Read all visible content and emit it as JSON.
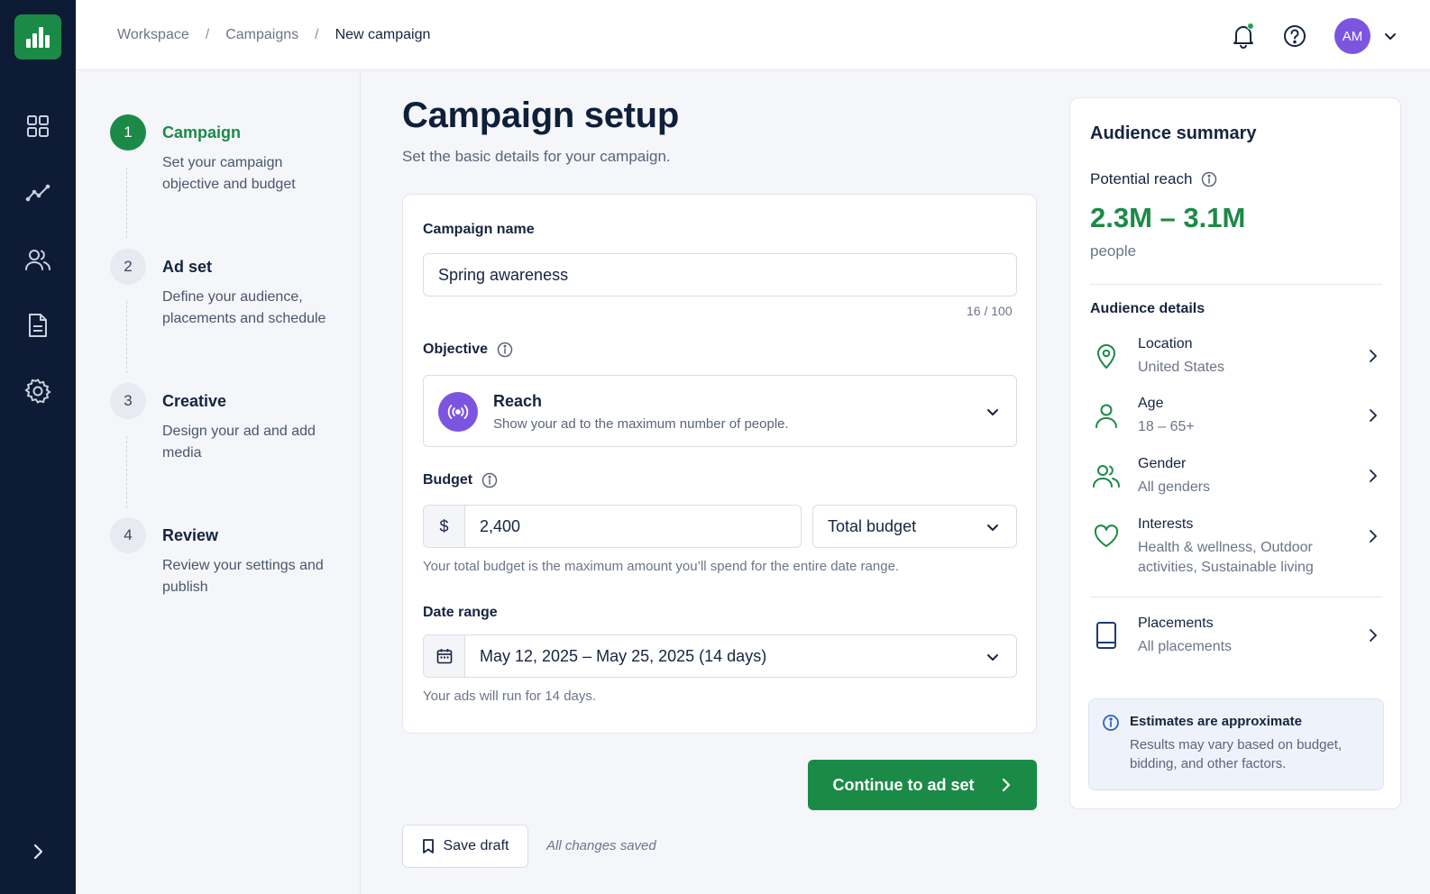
{
  "breadcrumb": [
    "Workspace",
    "Campaigns",
    "New campaign"
  ],
  "user": {
    "initials": "AM"
  },
  "nav": [
    "dashboard-icon",
    "analytics-icon",
    "audiences-icon",
    "reports-icon",
    "settings-icon"
  ],
  "steps": [
    {
      "number": "1",
      "title": "Campaign",
      "description": "Set your campaign objective and budget",
      "active": true
    },
    {
      "number": "2",
      "title": "Ad set",
      "description": "Define your audience, placements and schedule",
      "active": false
    },
    {
      "number": "3",
      "title": "Creative",
      "description": "Design your ad and add media",
      "active": false
    },
    {
      "number": "4",
      "title": "Review",
      "description": "Review your settings and publish",
      "active": false
    }
  ],
  "page": {
    "title": "Campaign setup",
    "subtitle": "Set the basic details for your campaign."
  },
  "form": {
    "campaign_name_label": "Campaign name",
    "campaign_name_value": "Spring awareness",
    "campaign_name_counter": "16 / 100",
    "objective_label": "Objective",
    "objective_title": "Reach",
    "objective_desc": "Show your ad to the maximum number of people.",
    "budget_label": "Budget",
    "budget_currency": "$",
    "budget_value": "2,400",
    "budget_type": "Total budget",
    "budget_help": "Your total budget is the maximum amount you’ll spend for the entire date range.",
    "date_label": "Date range",
    "date_value": "May 12, 2025 – May 25, 2025 (14 days)",
    "date_help": "Your ads will run for 14 days."
  },
  "actions": {
    "continue_label": "Continue to ad set",
    "save_label": "Save draft",
    "saved_status": "All changes saved"
  },
  "summary": {
    "title": "Audience summary",
    "reach_label": "Potential reach",
    "reach_value": "2.3M – 3.1M",
    "reach_unit": "people",
    "details_label": "Audience details",
    "rows": [
      {
        "title": "Location",
        "value": "United States",
        "icon": "location-pin-icon"
      },
      {
        "title": "Age",
        "value": "18 – 65+",
        "icon": "person-icon"
      },
      {
        "title": "Gender",
        "value": "All genders",
        "icon": "people-icon"
      },
      {
        "title": "Interests",
        "value": "Health & wellness, Outdoor activities, Sustainable living",
        "icon": "heart-icon"
      },
      {
        "title": "Placements",
        "value": "All placements",
        "icon": "tablet-icon"
      }
    ],
    "note_title": "Estimates are approximate",
    "note_text": "Results may vary based on budget, bidding, and other factors."
  },
  "colors": {
    "brand_green": "#1c8a47",
    "nav_bg": "#0e1b35",
    "accent_purple": "#7b55e0"
  }
}
